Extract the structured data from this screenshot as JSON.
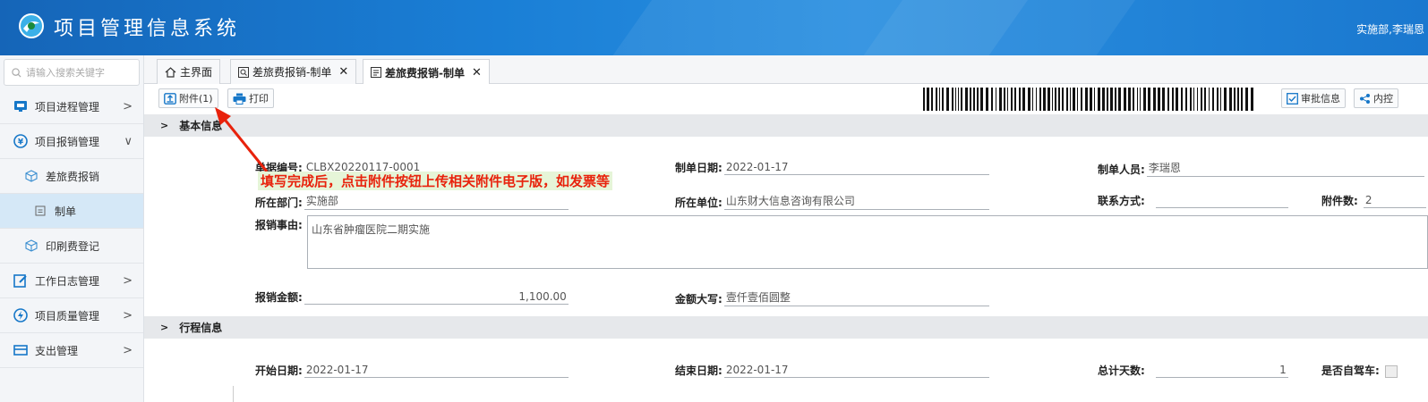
{
  "header": {
    "title": "项目管理信息系统",
    "user": "实施部,李瑞恩"
  },
  "sidebar": {
    "search_placeholder": "请输入搜索关键字",
    "items": [
      {
        "label": "项目进程管理",
        "icon": "project-progress-icon",
        "arrow": ">"
      },
      {
        "label": "项目报销管理",
        "icon": "reimburse-icon",
        "arrow": "∨"
      },
      {
        "label": "差旅费报销",
        "icon": "cube-icon"
      },
      {
        "label": "制单",
        "icon": "document-icon"
      },
      {
        "label": "印刷费登记",
        "icon": "cube-icon"
      },
      {
        "label": "工作日志管理",
        "icon": "worklog-icon",
        "arrow": ">"
      },
      {
        "label": "项目质量管理",
        "icon": "quality-icon",
        "arrow": ">"
      },
      {
        "label": "支出管理",
        "icon": "expense-icon",
        "arrow": ">"
      }
    ]
  },
  "tabs": [
    {
      "label": "主界面"
    },
    {
      "label": "差旅费报销-制单",
      "close": "✕"
    },
    {
      "label": "差旅费报销-制单",
      "close": "✕"
    }
  ],
  "toolbar": {
    "attach_label": "附件(1)",
    "print_label": "打印",
    "approval_label": "审批信息",
    "internal_label": "内控"
  },
  "sections": {
    "basic": "基本信息",
    "trip": "行程信息"
  },
  "basic": {
    "doc_no_label": "单据编号:",
    "doc_no": "CLBX20220117-0001",
    "date_label": "制单日期:",
    "date": "2022-01-17",
    "creator_label": "制单人员:",
    "creator": "李瑞恩",
    "dept_label": "所在部门:",
    "dept": "实施部",
    "unit_label": "所在单位:",
    "unit": "山东财大信息咨询有限公司",
    "contact_label": "联系方式:",
    "contact": "",
    "attach_count_label": "附件数:",
    "attach_count": "2",
    "reason_label": "报销事由:",
    "reason": "山东省肿瘤医院二期实施",
    "amount_label": "报销金额:",
    "amount": "1,100.00",
    "amount_cn_label": "金额大写:",
    "amount_cn": "壹仟壹佰圆整"
  },
  "trip": {
    "start_label": "开始日期:",
    "start": "2022-01-17",
    "end_label": "结束日期:",
    "end": "2022-01-17",
    "days_label": "总计天数:",
    "days": "1",
    "selfdrive_label": "是否自驾车:"
  },
  "annotation": "填写完成后，点击附件按钮上传相关附件电子版，如发票等",
  "colors": {
    "header": "#1a7fd6",
    "annotation": "#e8220c",
    "annotation_bg": "#e6f5d8",
    "selected_sidebar": "#d5e8f7"
  }
}
